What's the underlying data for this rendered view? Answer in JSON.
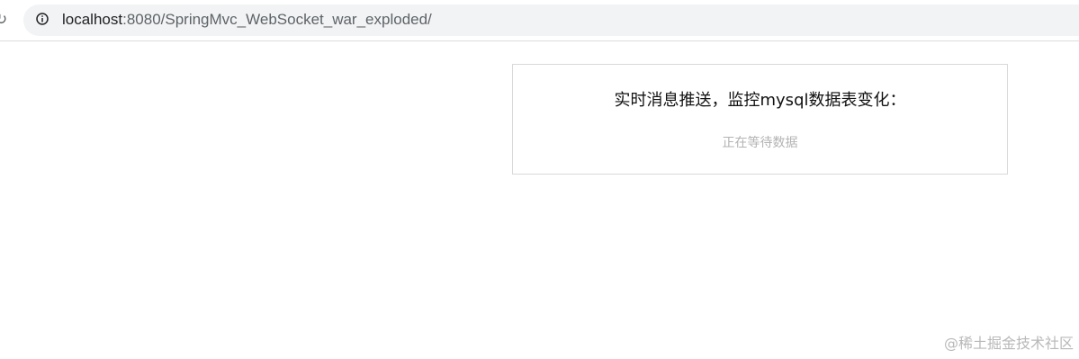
{
  "browser": {
    "url_host": "localhost",
    "url_rest": ":8080/SpringMvc_WebSocket_war_exploded/"
  },
  "icons": {
    "reload": "reload-icon",
    "site_info": "info-icon"
  },
  "panel": {
    "title": "实时消息推送，监控mysql数据表变化：",
    "status": "正在等待数据"
  },
  "watermark": {
    "text": "@稀土掘金技术社区"
  }
}
